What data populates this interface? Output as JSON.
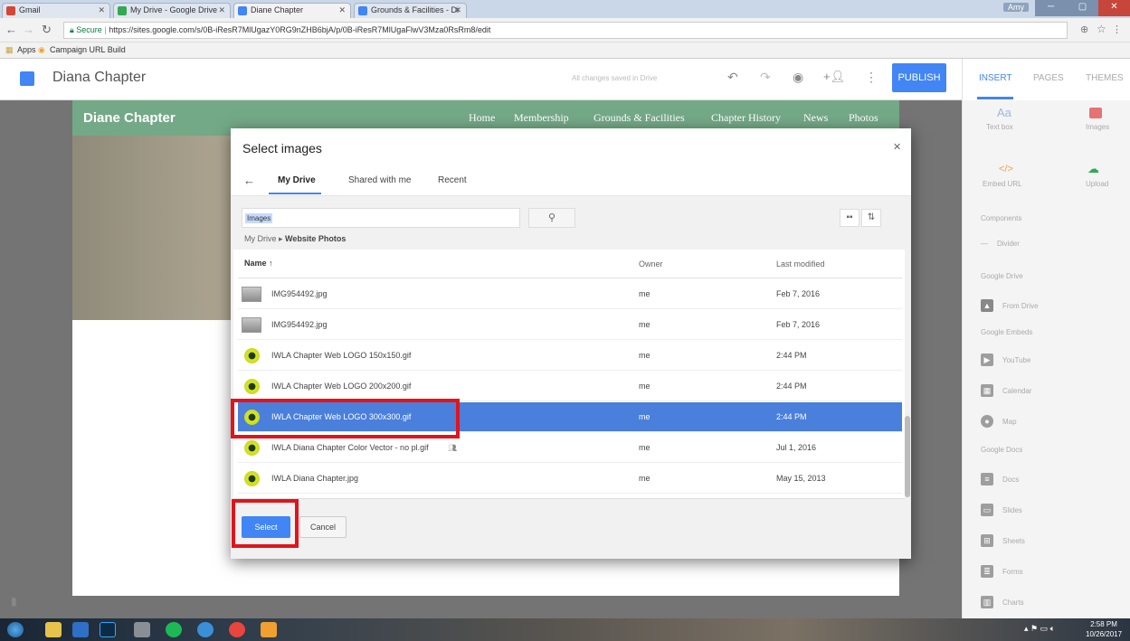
{
  "browser": {
    "tabs": [
      {
        "label": "Gmail",
        "favcolor": "#d44638"
      },
      {
        "label": "My Drive - Google Drive",
        "favcolor": "#34a853"
      },
      {
        "label": "Diane Chapter",
        "favcolor": "#4285f4"
      },
      {
        "label": "Grounds & Facilities - Di",
        "favcolor": "#4285f4"
      }
    ],
    "url_secure": "Secure",
    "url": "https://sites.google.com/s/0B-iResR7MlUgazY0RG9nZHB6bjA/p/0B-iResR7MlUgaFlwV3Mza0RsRm8/edit",
    "bookmarks": [
      "Apps",
      "Campaign URL Build"
    ],
    "user": "Amy"
  },
  "editor": {
    "site_name": "Diana Chapter",
    "save_status": "All changes saved in Drive",
    "publish_label": "PUBLISH"
  },
  "site": {
    "title": "Diane Chapter",
    "nav": [
      "Home",
      "Membership",
      "Grounds & Facilities",
      "Chapter History",
      "News",
      "Photos"
    ]
  },
  "panel": {
    "tabs": [
      "INSERT",
      "PAGES",
      "THEMES"
    ],
    "items": {
      "textbox": "Text box",
      "images": "Images",
      "embed": "Embed URL",
      "upload": "Upload",
      "components": "Components",
      "divider": "Divider",
      "google_drive": "Google Drive",
      "from_drive": "From Drive",
      "google_embeds": "Google Embeds",
      "youtube": "YouTube",
      "calendar": "Calendar",
      "map": "Map",
      "google_docs": "Google Docs",
      "docs": "Docs",
      "slides": "Slides",
      "sheets": "Sheets",
      "forms": "Forms",
      "charts": "Charts"
    }
  },
  "dialog": {
    "title": "Select images",
    "tabs": [
      "My Drive",
      "Shared with me",
      "Recent"
    ],
    "search_value": "Images",
    "breadcrumb_root": "My Drive",
    "breadcrumb_current": "Website Photos",
    "columns": [
      "Name",
      "Owner",
      "Last modified"
    ],
    "files": [
      {
        "name": "IMG954492.jpg",
        "owner": "me",
        "modified": "Feb 7, 2016",
        "kind": "photo"
      },
      {
        "name": "IMG954492.jpg",
        "owner": "me",
        "modified": "Feb 7, 2016",
        "kind": "photo"
      },
      {
        "name": "IWLA Chapter Web LOGO 150x150.gif",
        "owner": "me",
        "modified": "2:44 PM",
        "kind": "logo"
      },
      {
        "name": "IWLA Chapter Web LOGO 200x200.gif",
        "owner": "me",
        "modified": "2:44 PM",
        "kind": "logo"
      },
      {
        "name": "IWLA Chapter Web LOGO 300x300.gif",
        "owner": "me",
        "modified": "2:44 PM",
        "kind": "logo",
        "selected": true
      },
      {
        "name": "IWLA Diana Chapter Color Vector - no pl.gif",
        "owner": "me",
        "modified": "Jul 1, 2016",
        "kind": "logo",
        "shared": true
      },
      {
        "name": "IWLA Diana Chapter.jpg",
        "owner": "me",
        "modified": "May 15, 2013",
        "kind": "logo"
      }
    ],
    "select_label": "Select",
    "cancel_label": "Cancel"
  },
  "taskbar": {
    "time": "2:58 PM",
    "date": "10/26/2017"
  }
}
